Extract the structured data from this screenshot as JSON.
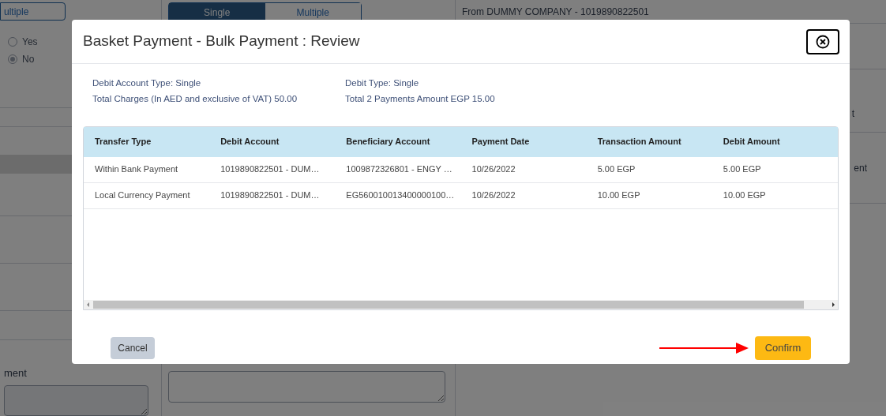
{
  "background": {
    "left_toggle": {
      "label": "ultiple"
    },
    "radios": [
      {
        "label": "Yes",
        "checked": false
      },
      {
        "label": "No",
        "checked": true
      }
    ],
    "left_label": "ment",
    "toggle": [
      {
        "label": "Single",
        "selected": true
      },
      {
        "label": "Multiple",
        "selected": false
      }
    ],
    "from_account": "From DUMMY COMPANY - 1019890822501",
    "right_labels": [
      "t",
      "ent"
    ]
  },
  "dialog": {
    "title": "Basket Payment - Bulk Payment : Review",
    "summary": [
      [
        "Debit Account Type: Single",
        "Total Charges (In AED and exclusive of VAT) 50.00"
      ],
      [
        "Debit Type: Single",
        "Total 2 Payments Amount EGP 15.00"
      ]
    ],
    "table": {
      "columns": [
        "Transfer Type",
        "Debit Account",
        "Beneficiary Account",
        "Payment Date",
        "Transaction Amount",
        "Debit Amount"
      ],
      "rows": [
        [
          "Within Bank Payment",
          "1019890822501 - DUM…",
          "1009872326801 - ENGY …",
          "10/26/2022",
          "5.00 EGP",
          "5.00 EGP"
        ],
        [
          "Local Currency Payment",
          "1019890822501 - DUM…",
          "EG560010013400000100…",
          "10/26/2022",
          "10.00 EGP",
          "10.00 EGP"
        ]
      ]
    },
    "buttons": [
      {
        "label": "Cancel",
        "kind": "secondary"
      },
      {
        "label": "Confirm",
        "kind": "primary"
      }
    ]
  }
}
